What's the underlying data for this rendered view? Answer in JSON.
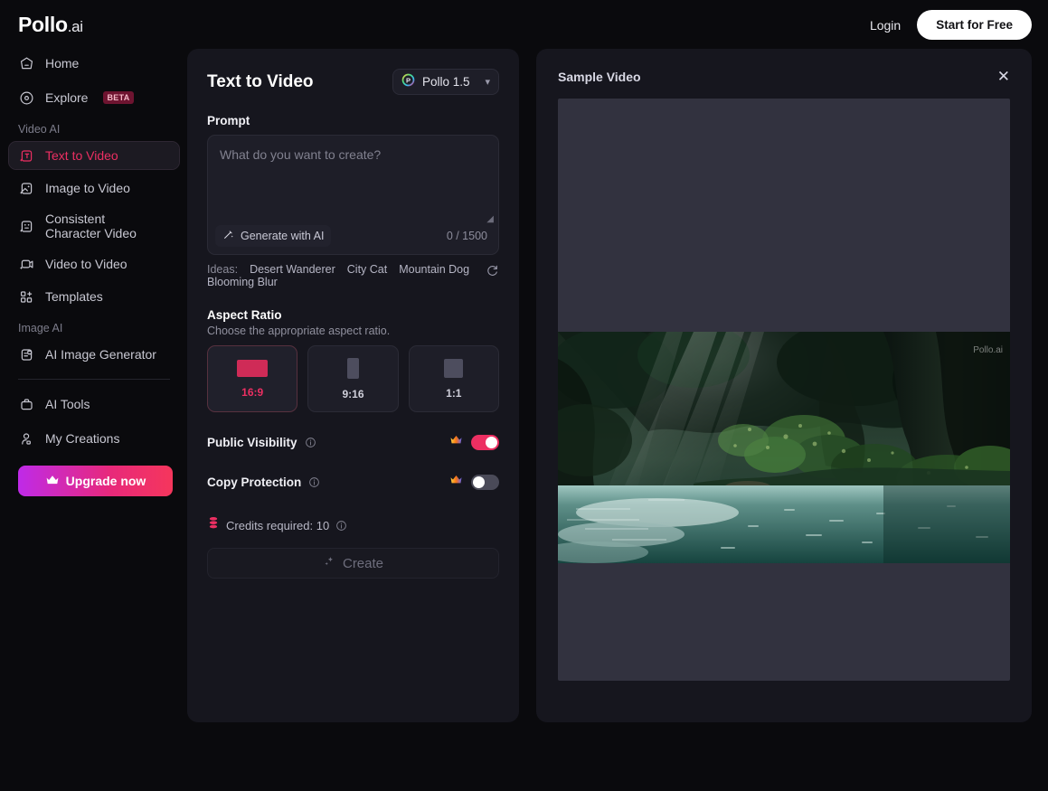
{
  "brand": {
    "name": "Pollo",
    "suffix": ".ai"
  },
  "topnav": {
    "login": "Login",
    "cta": "Start for Free"
  },
  "sidebar": {
    "primary": [
      {
        "label": "Home",
        "icon": "home-icon"
      },
      {
        "label": "Explore",
        "icon": "compass-icon",
        "badge": "BETA"
      }
    ],
    "groups": [
      {
        "title": "Video AI",
        "items": [
          {
            "label": "Text to Video",
            "icon": "text-to-video-icon",
            "active": true
          },
          {
            "label": "Image to Video",
            "icon": "image-to-video-icon",
            "active": false
          },
          {
            "label": "Consistent Character Video",
            "icon": "consistent-character-icon",
            "active": false
          },
          {
            "label": "Video to Video",
            "icon": "video-to-video-icon",
            "active": false
          },
          {
            "label": "Templates",
            "icon": "templates-icon",
            "active": false
          }
        ]
      },
      {
        "title": "Image AI",
        "items": [
          {
            "label": "AI Image Generator",
            "icon": "ai-image-generator-icon",
            "active": false
          }
        ]
      }
    ],
    "tools": [
      {
        "label": "AI Tools",
        "icon": "toolbox-icon"
      },
      {
        "label": "My Creations",
        "icon": "user-icon"
      }
    ],
    "upgrade": {
      "label": "Upgrade now",
      "icon": "crown-icon"
    }
  },
  "form": {
    "title": "Text to Video",
    "model": {
      "name": "Pollo 1.5",
      "icon": "pollo-logo-icon",
      "chevron": "chevron-down-icon"
    },
    "prompt": {
      "label": "Prompt",
      "placeholder": "What do you want to create?",
      "value": "",
      "generate_with_ai": "Generate with AI",
      "counter": "0 / 1500"
    },
    "ideas": {
      "label": "Ideas:",
      "items": [
        "Desert Wanderer",
        "City Cat",
        "Mountain Dog",
        "Blooming Blur"
      ],
      "refresh_icon": "refresh-icon"
    },
    "aspect_ratio": {
      "title": "Aspect Ratio",
      "description": "Choose the appropriate aspect ratio.",
      "options": [
        {
          "label": "16:9",
          "selected": true
        },
        {
          "label": "9:16",
          "selected": false
        },
        {
          "label": "1:1",
          "selected": false
        }
      ]
    },
    "toggles": [
      {
        "label": "Public Visibility",
        "state": "on",
        "premium_icon": "crown-icon",
        "info_icon": "info-icon"
      },
      {
        "label": "Copy Protection",
        "state": "off",
        "premium_icon": "crown-icon",
        "info_icon": "info-icon"
      }
    ],
    "credits": {
      "text": "Credits required: 10",
      "icon": "credits-coins-icon",
      "info_icon": "info-icon"
    },
    "create_button": {
      "label": "Create",
      "icon": "sparkles-icon",
      "disabled": true
    }
  },
  "preview": {
    "title": "Sample Video",
    "close_icon": "close-icon",
    "watermark": {
      "name": "Pollo",
      "suffix": ".ai"
    }
  },
  "colors": {
    "accent_pink": "#ec2f62",
    "panel_bg": "#16161e",
    "page_bg": "#0a0a0d",
    "upgrade_gradient_start": "#bf2ae8",
    "upgrade_gradient_end": "#f5365c"
  }
}
